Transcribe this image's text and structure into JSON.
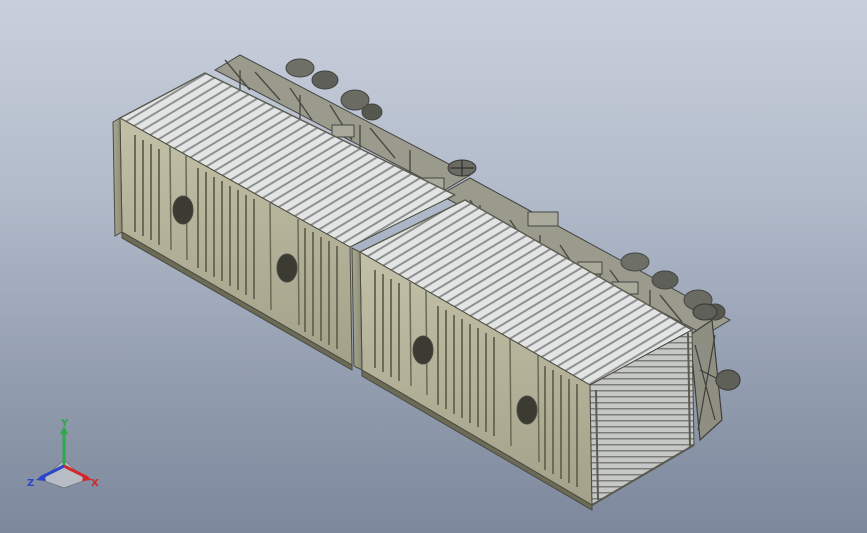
{
  "viewport": {
    "background_top": "#c9d0dc",
    "background_bottom": "#7d889c"
  },
  "model": {
    "body_color": "#b5b39a",
    "body_dark": "#8f8d74",
    "roof_color": "#d9dcdc",
    "structure_color": "#7e7f72"
  },
  "triad": {
    "x_label": "X",
    "y_label": "Y",
    "z_label": "Z",
    "x_color": "#d22828",
    "y_color": "#2ea84a",
    "z_color": "#2b46c8"
  }
}
